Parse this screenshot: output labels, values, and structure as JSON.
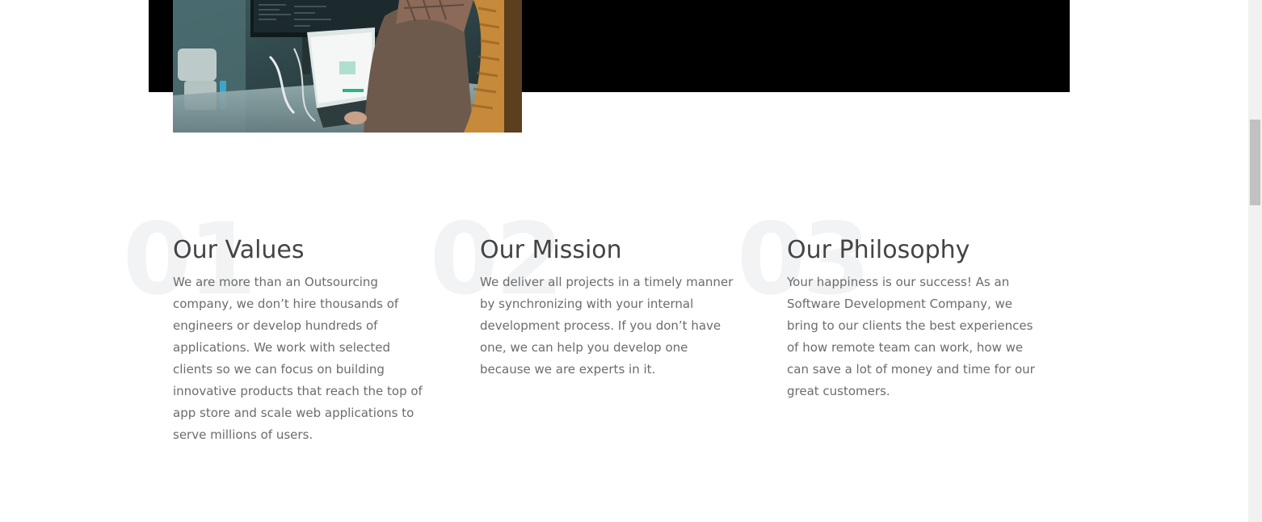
{
  "hero": {
    "photo": "developer-at-laptop-photo"
  },
  "features": [
    {
      "number": "01",
      "title": "Our Values",
      "text": "We are more than an Outsourcing company, we don’t hire thousands of engineers or develop hundreds of applications. We work with selected clients so we can focus on building innovative products that reach the top of app store and scale web applications to serve millions of users."
    },
    {
      "number": "02",
      "title": "Our Mission",
      "text": "We deliver all projects in a timely manner by synchronizing with your internal development process. If you don’t have one, we can help you develop one because we are experts in it."
    },
    {
      "number": "03",
      "title": "Our Philosophy",
      "text": "Your happiness is our success! As an Software Development Company, we bring to our clients the best experiences of how remote team can work, how we can save a lot of money and time for our great customers."
    }
  ],
  "colors": {
    "band": "#000000",
    "heading": "#444444",
    "body_text": "#6c6c6c",
    "watermark_number": "#f2f3f5"
  }
}
